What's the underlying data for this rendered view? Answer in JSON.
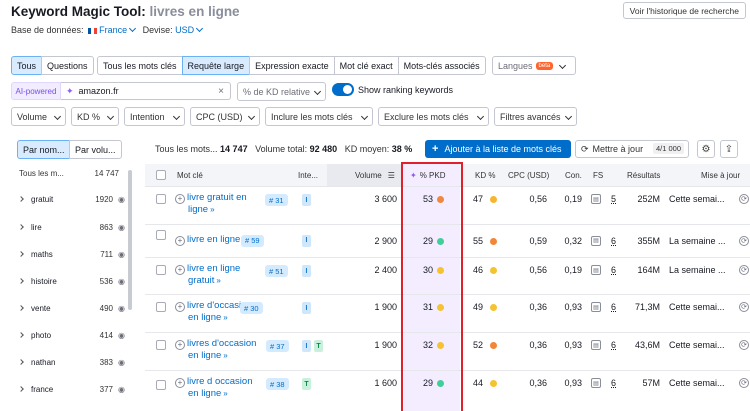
{
  "header": {
    "tool": "Keyword Magic Tool:",
    "query": "livres en ligne",
    "history_button": "Voir l'historique de recherche",
    "db_label": "Base de données:",
    "db_value": "France",
    "currency_label": "Devise:",
    "currency_value": "USD"
  },
  "tabs": {
    "all": "Tous",
    "questions": "Questions",
    "all_keywords": "Tous les mots clés",
    "broad": "Requête large",
    "phrase": "Expression exacte",
    "exact": "Mot clé exact",
    "related": "Mots-clés associés",
    "languages": "Langues",
    "beta": "beta"
  },
  "ai": {
    "badge": "AI-powered",
    "domain_value": "amazon.fr",
    "kd_select": "% de KD relative",
    "toggle_label": "Show ranking keywords"
  },
  "filters": [
    "Volume",
    "KD %",
    "Intention",
    "CPC (USD)",
    "Inclure les mots clés",
    "Exclure les mots clés",
    "Filtres avancés"
  ],
  "left_panel": {
    "tab_name": "Par nom...",
    "tab_volume": "Par volu...",
    "header_label": "Tous les m...",
    "header_count": "14 747",
    "groups": [
      {
        "label": "gratuit",
        "count": "1920"
      },
      {
        "label": "lire",
        "count": "863"
      },
      {
        "label": "maths",
        "count": "711"
      },
      {
        "label": "histoire",
        "count": "536"
      },
      {
        "label": "vente",
        "count": "490"
      },
      {
        "label": "photo",
        "count": "414"
      },
      {
        "label": "nathan",
        "count": "383"
      },
      {
        "label": "france",
        "count": "377"
      }
    ]
  },
  "summary": {
    "all_label": "Tous les mots...",
    "all_value": "14 747",
    "volume_label": "Volume total:",
    "volume_value": "92 480",
    "kd_label": "KD moyen:",
    "kd_value": "38 %",
    "add_button": "Ajouter à la liste de mots clés",
    "update_button": "Mettre à jour",
    "update_count": "4/1 000"
  },
  "table": {
    "columns": {
      "keyword": "Mot clé",
      "intent": "Inte...",
      "volume": "Volume",
      "pkd": "% PKD",
      "kd": "KD %",
      "cpc": "CPC (USD)",
      "com": "Con.",
      "fs": "FS",
      "results": "Résultats",
      "trend": "Mise à jour"
    },
    "rows": [
      {
        "kw1": "livre gratuit en",
        "kw2": "ligne",
        "pos": "# 31",
        "intents": [
          "I"
        ],
        "volume": "3 600",
        "pkd": "53",
        "pkd_color": "#f0883c",
        "kd": "47",
        "kd_color": "#f5b732",
        "cpc": "0,56",
        "com": "0,19",
        "fs": "5",
        "results": "252M",
        "trend": "Cette semai..."
      },
      {
        "kw1": "livre en ligne",
        "kw2": "",
        "pos": "# 59",
        "intents": [
          "I"
        ],
        "volume": "2 900",
        "pkd": "29",
        "pkd_color": "#3fcf9a",
        "kd": "55",
        "kd_color": "#f0883c",
        "cpc": "0,59",
        "com": "0,32",
        "fs": "6",
        "results": "355M",
        "trend": "La semaine ..."
      },
      {
        "kw1": "livre en ligne",
        "kw2": "gratuit",
        "pos": "# 51",
        "intents": [
          "I"
        ],
        "volume": "2 400",
        "pkd": "30",
        "pkd_color": "#f5c232",
        "kd": "46",
        "kd_color": "#f5c232",
        "cpc": "0,56",
        "com": "0,19",
        "fs": "6",
        "results": "164M",
        "trend": "La semaine ..."
      },
      {
        "kw1": "livre d'occasion",
        "kw2": "en ligne",
        "pos": "# 30",
        "intents": [
          "I"
        ],
        "volume": "1 900",
        "pkd": "31",
        "pkd_color": "#f5c232",
        "kd": "49",
        "kd_color": "#f5c232",
        "cpc": "0,36",
        "com": "0,93",
        "fs": "6",
        "results": "71,3M",
        "trend": "Cette semai..."
      },
      {
        "kw1": "livres d'occasion",
        "kw2": "en ligne",
        "pos": "# 37",
        "intents": [
          "I",
          "T"
        ],
        "volume": "1 900",
        "pkd": "32",
        "pkd_color": "#f5c232",
        "kd": "52",
        "kd_color": "#f0883c",
        "cpc": "0,36",
        "com": "0,93",
        "fs": "6",
        "results": "43,6M",
        "trend": "Cette semai..."
      },
      {
        "kw1": "livre d occasion",
        "kw2": "en ligne",
        "pos": "# 38",
        "intents": [
          "T"
        ],
        "volume": "1 600",
        "pkd": "29",
        "pkd_color": "#3fcf9a",
        "kd": "44",
        "kd_color": "#f5c232",
        "cpc": "0,36",
        "com": "0,93",
        "fs": "6",
        "results": "57M",
        "trend": "Cette semai..."
      }
    ]
  }
}
